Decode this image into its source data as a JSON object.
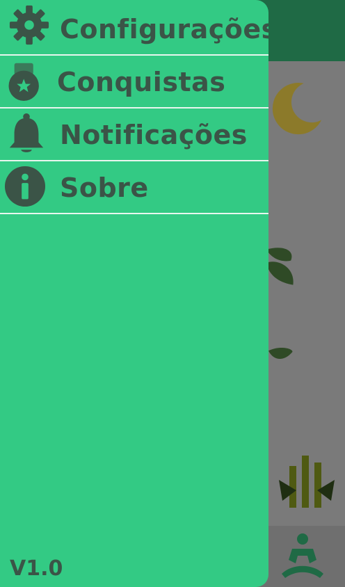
{
  "drawer": {
    "items": [
      {
        "label": "Configurações",
        "icon": "gear-icon"
      },
      {
        "label": "Conquistas",
        "icon": "badge-icon"
      },
      {
        "label": "Notificações",
        "icon": "bell-icon"
      },
      {
        "label": "Sobre",
        "icon": "info-icon"
      }
    ],
    "version": "V1.0"
  },
  "colors": {
    "drawer_bg": "#33ca84",
    "text": "#3b5447",
    "divider": "#e8f6ee",
    "scrim_topbar": "#1f6a45"
  }
}
